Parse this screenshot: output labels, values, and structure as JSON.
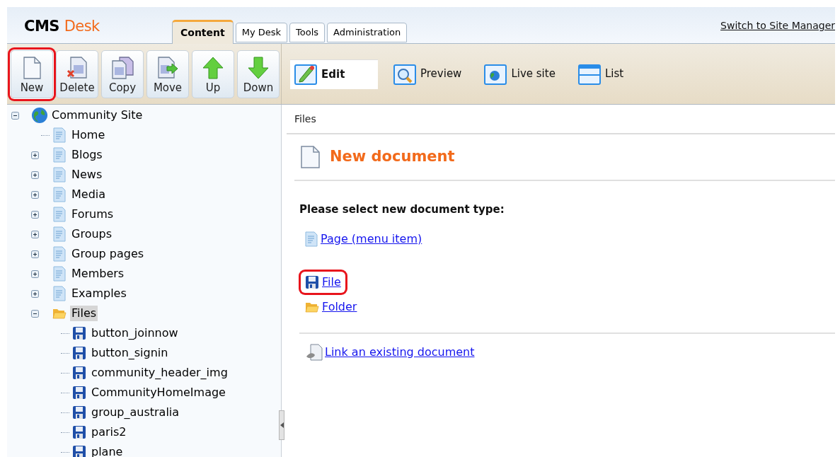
{
  "header": {
    "logo_main": "CMS",
    "logo_accent": "Desk",
    "switch_link": "Switch to Site Manager"
  },
  "tabs": [
    {
      "label": "Content",
      "selected": true
    },
    {
      "label": "My Desk",
      "selected": false
    },
    {
      "label": "Tools",
      "selected": false
    },
    {
      "label": "Administration",
      "selected": false
    }
  ],
  "toolbar": [
    {
      "label": "New",
      "kind": "new",
      "highlighted": true
    },
    {
      "label": "Delete",
      "kind": "delete",
      "highlighted": false
    },
    {
      "label": "Copy",
      "kind": "copy",
      "highlighted": false
    },
    {
      "label": "Move",
      "kind": "move",
      "highlighted": false
    },
    {
      "label": "Up",
      "kind": "up",
      "highlighted": false
    },
    {
      "label": "Down",
      "kind": "down",
      "highlighted": false
    }
  ],
  "view_modes": [
    {
      "label": "Edit",
      "kind": "edit",
      "selected": true
    },
    {
      "label": "Preview",
      "kind": "preview",
      "selected": false
    },
    {
      "label": "Live site",
      "kind": "live",
      "selected": false
    },
    {
      "label": "List",
      "kind": "list",
      "selected": false
    }
  ],
  "tree": [
    {
      "label": "Community Site",
      "kind": "globe",
      "expanded": true,
      "selected": false,
      "children": [
        {
          "label": "Home",
          "kind": "page",
          "selected": false
        },
        {
          "label": "Blogs",
          "kind": "page",
          "expanded": false,
          "selected": false
        },
        {
          "label": "News",
          "kind": "page",
          "expanded": false,
          "selected": false
        },
        {
          "label": "Media",
          "kind": "page",
          "expanded": false,
          "selected": false
        },
        {
          "label": "Forums",
          "kind": "page",
          "expanded": false,
          "selected": false
        },
        {
          "label": "Groups",
          "kind": "page",
          "expanded": false,
          "selected": false
        },
        {
          "label": "Group pages",
          "kind": "page",
          "expanded": false,
          "selected": false
        },
        {
          "label": "Members",
          "kind": "page",
          "expanded": false,
          "selected": false
        },
        {
          "label": "Examples",
          "kind": "page",
          "expanded": false,
          "selected": false
        },
        {
          "label": "Files",
          "kind": "folder",
          "expanded": true,
          "selected": true,
          "children": [
            {
              "label": "button_joinnow",
              "kind": "file",
              "selected": false
            },
            {
              "label": "button_signin",
              "kind": "file",
              "selected": false
            },
            {
              "label": "community_header_img",
              "kind": "file",
              "selected": false
            },
            {
              "label": "CommunityHomeImage",
              "kind": "file",
              "selected": false
            },
            {
              "label": "group_australia",
              "kind": "file",
              "selected": false
            },
            {
              "label": "paris2",
              "kind": "file",
              "selected": false
            },
            {
              "label": "plane",
              "kind": "file",
              "selected": false
            }
          ]
        }
      ]
    }
  ],
  "content": {
    "breadcrumb": "Files",
    "title": "New document",
    "prompt": "Please select new document type:",
    "document_types": [
      {
        "label": "Page (menu item)",
        "kind": "page",
        "highlighted": false
      },
      {
        "label": "File",
        "kind": "file",
        "highlighted": true
      },
      {
        "label": "Folder",
        "kind": "folder",
        "highlighted": false
      }
    ],
    "link_existing": "Link an existing document"
  }
}
